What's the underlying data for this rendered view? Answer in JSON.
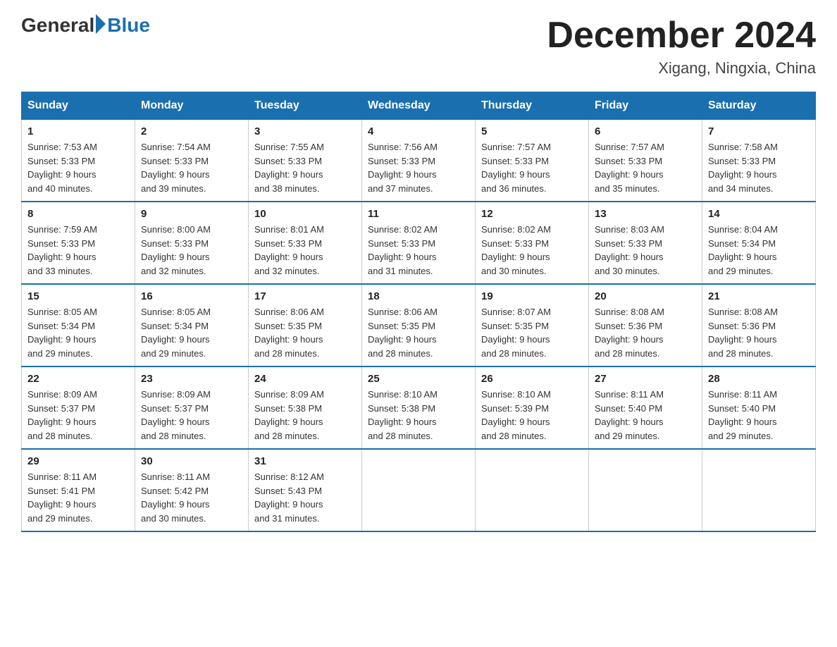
{
  "header": {
    "logo_general": "General",
    "logo_blue": "Blue",
    "month_title": "December 2024",
    "location": "Xigang, Ningxia, China"
  },
  "weekdays": [
    "Sunday",
    "Monday",
    "Tuesday",
    "Wednesday",
    "Thursday",
    "Friday",
    "Saturday"
  ],
  "weeks": [
    [
      {
        "day": "1",
        "sunrise": "7:53 AM",
        "sunset": "5:33 PM",
        "daylight": "9 hours and 40 minutes."
      },
      {
        "day": "2",
        "sunrise": "7:54 AM",
        "sunset": "5:33 PM",
        "daylight": "9 hours and 39 minutes."
      },
      {
        "day": "3",
        "sunrise": "7:55 AM",
        "sunset": "5:33 PM",
        "daylight": "9 hours and 38 minutes."
      },
      {
        "day": "4",
        "sunrise": "7:56 AM",
        "sunset": "5:33 PM",
        "daylight": "9 hours and 37 minutes."
      },
      {
        "day": "5",
        "sunrise": "7:57 AM",
        "sunset": "5:33 PM",
        "daylight": "9 hours and 36 minutes."
      },
      {
        "day": "6",
        "sunrise": "7:57 AM",
        "sunset": "5:33 PM",
        "daylight": "9 hours and 35 minutes."
      },
      {
        "day": "7",
        "sunrise": "7:58 AM",
        "sunset": "5:33 PM",
        "daylight": "9 hours and 34 minutes."
      }
    ],
    [
      {
        "day": "8",
        "sunrise": "7:59 AM",
        "sunset": "5:33 PM",
        "daylight": "9 hours and 33 minutes."
      },
      {
        "day": "9",
        "sunrise": "8:00 AM",
        "sunset": "5:33 PM",
        "daylight": "9 hours and 32 minutes."
      },
      {
        "day": "10",
        "sunrise": "8:01 AM",
        "sunset": "5:33 PM",
        "daylight": "9 hours and 32 minutes."
      },
      {
        "day": "11",
        "sunrise": "8:02 AM",
        "sunset": "5:33 PM",
        "daylight": "9 hours and 31 minutes."
      },
      {
        "day": "12",
        "sunrise": "8:02 AM",
        "sunset": "5:33 PM",
        "daylight": "9 hours and 30 minutes."
      },
      {
        "day": "13",
        "sunrise": "8:03 AM",
        "sunset": "5:33 PM",
        "daylight": "9 hours and 30 minutes."
      },
      {
        "day": "14",
        "sunrise": "8:04 AM",
        "sunset": "5:34 PM",
        "daylight": "9 hours and 29 minutes."
      }
    ],
    [
      {
        "day": "15",
        "sunrise": "8:05 AM",
        "sunset": "5:34 PM",
        "daylight": "9 hours and 29 minutes."
      },
      {
        "day": "16",
        "sunrise": "8:05 AM",
        "sunset": "5:34 PM",
        "daylight": "9 hours and 29 minutes."
      },
      {
        "day": "17",
        "sunrise": "8:06 AM",
        "sunset": "5:35 PM",
        "daylight": "9 hours and 28 minutes."
      },
      {
        "day": "18",
        "sunrise": "8:06 AM",
        "sunset": "5:35 PM",
        "daylight": "9 hours and 28 minutes."
      },
      {
        "day": "19",
        "sunrise": "8:07 AM",
        "sunset": "5:35 PM",
        "daylight": "9 hours and 28 minutes."
      },
      {
        "day": "20",
        "sunrise": "8:08 AM",
        "sunset": "5:36 PM",
        "daylight": "9 hours and 28 minutes."
      },
      {
        "day": "21",
        "sunrise": "8:08 AM",
        "sunset": "5:36 PM",
        "daylight": "9 hours and 28 minutes."
      }
    ],
    [
      {
        "day": "22",
        "sunrise": "8:09 AM",
        "sunset": "5:37 PM",
        "daylight": "9 hours and 28 minutes."
      },
      {
        "day": "23",
        "sunrise": "8:09 AM",
        "sunset": "5:37 PM",
        "daylight": "9 hours and 28 minutes."
      },
      {
        "day": "24",
        "sunrise": "8:09 AM",
        "sunset": "5:38 PM",
        "daylight": "9 hours and 28 minutes."
      },
      {
        "day": "25",
        "sunrise": "8:10 AM",
        "sunset": "5:38 PM",
        "daylight": "9 hours and 28 minutes."
      },
      {
        "day": "26",
        "sunrise": "8:10 AM",
        "sunset": "5:39 PM",
        "daylight": "9 hours and 28 minutes."
      },
      {
        "day": "27",
        "sunrise": "8:11 AM",
        "sunset": "5:40 PM",
        "daylight": "9 hours and 29 minutes."
      },
      {
        "day": "28",
        "sunrise": "8:11 AM",
        "sunset": "5:40 PM",
        "daylight": "9 hours and 29 minutes."
      }
    ],
    [
      {
        "day": "29",
        "sunrise": "8:11 AM",
        "sunset": "5:41 PM",
        "daylight": "9 hours and 29 minutes."
      },
      {
        "day": "30",
        "sunrise": "8:11 AM",
        "sunset": "5:42 PM",
        "daylight": "9 hours and 30 minutes."
      },
      {
        "day": "31",
        "sunrise": "8:12 AM",
        "sunset": "5:43 PM",
        "daylight": "9 hours and 31 minutes."
      },
      null,
      null,
      null,
      null
    ]
  ],
  "labels": {
    "sunrise": "Sunrise:",
    "sunset": "Sunset:",
    "daylight": "Daylight:"
  }
}
